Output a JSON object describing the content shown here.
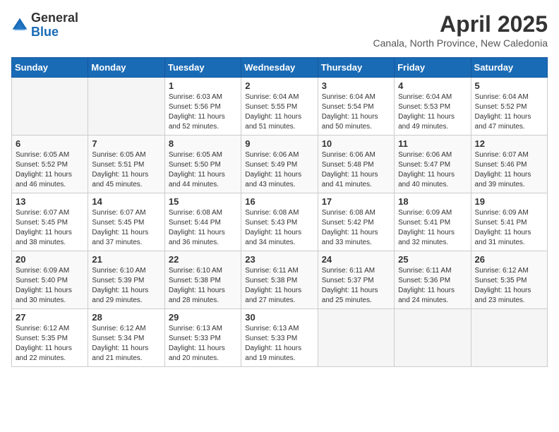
{
  "header": {
    "logo_general": "General",
    "logo_blue": "Blue",
    "month_title": "April 2025",
    "subtitle": "Canala, North Province, New Caledonia"
  },
  "weekdays": [
    "Sunday",
    "Monday",
    "Tuesday",
    "Wednesday",
    "Thursday",
    "Friday",
    "Saturday"
  ],
  "weeks": [
    [
      {
        "day": "",
        "sunrise": "",
        "sunset": "",
        "daylight": ""
      },
      {
        "day": "",
        "sunrise": "",
        "sunset": "",
        "daylight": ""
      },
      {
        "day": "1",
        "sunrise": "Sunrise: 6:03 AM",
        "sunset": "Sunset: 5:56 PM",
        "daylight": "Daylight: 11 hours and 52 minutes."
      },
      {
        "day": "2",
        "sunrise": "Sunrise: 6:04 AM",
        "sunset": "Sunset: 5:55 PM",
        "daylight": "Daylight: 11 hours and 51 minutes."
      },
      {
        "day": "3",
        "sunrise": "Sunrise: 6:04 AM",
        "sunset": "Sunset: 5:54 PM",
        "daylight": "Daylight: 11 hours and 50 minutes."
      },
      {
        "day": "4",
        "sunrise": "Sunrise: 6:04 AM",
        "sunset": "Sunset: 5:53 PM",
        "daylight": "Daylight: 11 hours and 49 minutes."
      },
      {
        "day": "5",
        "sunrise": "Sunrise: 6:04 AM",
        "sunset": "Sunset: 5:52 PM",
        "daylight": "Daylight: 11 hours and 47 minutes."
      }
    ],
    [
      {
        "day": "6",
        "sunrise": "Sunrise: 6:05 AM",
        "sunset": "Sunset: 5:52 PM",
        "daylight": "Daylight: 11 hours and 46 minutes."
      },
      {
        "day": "7",
        "sunrise": "Sunrise: 6:05 AM",
        "sunset": "Sunset: 5:51 PM",
        "daylight": "Daylight: 11 hours and 45 minutes."
      },
      {
        "day": "8",
        "sunrise": "Sunrise: 6:05 AM",
        "sunset": "Sunset: 5:50 PM",
        "daylight": "Daylight: 11 hours and 44 minutes."
      },
      {
        "day": "9",
        "sunrise": "Sunrise: 6:06 AM",
        "sunset": "Sunset: 5:49 PM",
        "daylight": "Daylight: 11 hours and 43 minutes."
      },
      {
        "day": "10",
        "sunrise": "Sunrise: 6:06 AM",
        "sunset": "Sunset: 5:48 PM",
        "daylight": "Daylight: 11 hours and 41 minutes."
      },
      {
        "day": "11",
        "sunrise": "Sunrise: 6:06 AM",
        "sunset": "Sunset: 5:47 PM",
        "daylight": "Daylight: 11 hours and 40 minutes."
      },
      {
        "day": "12",
        "sunrise": "Sunrise: 6:07 AM",
        "sunset": "Sunset: 5:46 PM",
        "daylight": "Daylight: 11 hours and 39 minutes."
      }
    ],
    [
      {
        "day": "13",
        "sunrise": "Sunrise: 6:07 AM",
        "sunset": "Sunset: 5:45 PM",
        "daylight": "Daylight: 11 hours and 38 minutes."
      },
      {
        "day": "14",
        "sunrise": "Sunrise: 6:07 AM",
        "sunset": "Sunset: 5:45 PM",
        "daylight": "Daylight: 11 hours and 37 minutes."
      },
      {
        "day": "15",
        "sunrise": "Sunrise: 6:08 AM",
        "sunset": "Sunset: 5:44 PM",
        "daylight": "Daylight: 11 hours and 36 minutes."
      },
      {
        "day": "16",
        "sunrise": "Sunrise: 6:08 AM",
        "sunset": "Sunset: 5:43 PM",
        "daylight": "Daylight: 11 hours and 34 minutes."
      },
      {
        "day": "17",
        "sunrise": "Sunrise: 6:08 AM",
        "sunset": "Sunset: 5:42 PM",
        "daylight": "Daylight: 11 hours and 33 minutes."
      },
      {
        "day": "18",
        "sunrise": "Sunrise: 6:09 AM",
        "sunset": "Sunset: 5:41 PM",
        "daylight": "Daylight: 11 hours and 32 minutes."
      },
      {
        "day": "19",
        "sunrise": "Sunrise: 6:09 AM",
        "sunset": "Sunset: 5:41 PM",
        "daylight": "Daylight: 11 hours and 31 minutes."
      }
    ],
    [
      {
        "day": "20",
        "sunrise": "Sunrise: 6:09 AM",
        "sunset": "Sunset: 5:40 PM",
        "daylight": "Daylight: 11 hours and 30 minutes."
      },
      {
        "day": "21",
        "sunrise": "Sunrise: 6:10 AM",
        "sunset": "Sunset: 5:39 PM",
        "daylight": "Daylight: 11 hours and 29 minutes."
      },
      {
        "day": "22",
        "sunrise": "Sunrise: 6:10 AM",
        "sunset": "Sunset: 5:38 PM",
        "daylight": "Daylight: 11 hours and 28 minutes."
      },
      {
        "day": "23",
        "sunrise": "Sunrise: 6:11 AM",
        "sunset": "Sunset: 5:38 PM",
        "daylight": "Daylight: 11 hours and 27 minutes."
      },
      {
        "day": "24",
        "sunrise": "Sunrise: 6:11 AM",
        "sunset": "Sunset: 5:37 PM",
        "daylight": "Daylight: 11 hours and 25 minutes."
      },
      {
        "day": "25",
        "sunrise": "Sunrise: 6:11 AM",
        "sunset": "Sunset: 5:36 PM",
        "daylight": "Daylight: 11 hours and 24 minutes."
      },
      {
        "day": "26",
        "sunrise": "Sunrise: 6:12 AM",
        "sunset": "Sunset: 5:35 PM",
        "daylight": "Daylight: 11 hours and 23 minutes."
      }
    ],
    [
      {
        "day": "27",
        "sunrise": "Sunrise: 6:12 AM",
        "sunset": "Sunset: 5:35 PM",
        "daylight": "Daylight: 11 hours and 22 minutes."
      },
      {
        "day": "28",
        "sunrise": "Sunrise: 6:12 AM",
        "sunset": "Sunset: 5:34 PM",
        "daylight": "Daylight: 11 hours and 21 minutes."
      },
      {
        "day": "29",
        "sunrise": "Sunrise: 6:13 AM",
        "sunset": "Sunset: 5:33 PM",
        "daylight": "Daylight: 11 hours and 20 minutes."
      },
      {
        "day": "30",
        "sunrise": "Sunrise: 6:13 AM",
        "sunset": "Sunset: 5:33 PM",
        "daylight": "Daylight: 11 hours and 19 minutes."
      },
      {
        "day": "",
        "sunrise": "",
        "sunset": "",
        "daylight": ""
      },
      {
        "day": "",
        "sunrise": "",
        "sunset": "",
        "daylight": ""
      },
      {
        "day": "",
        "sunrise": "",
        "sunset": "",
        "daylight": ""
      }
    ]
  ]
}
